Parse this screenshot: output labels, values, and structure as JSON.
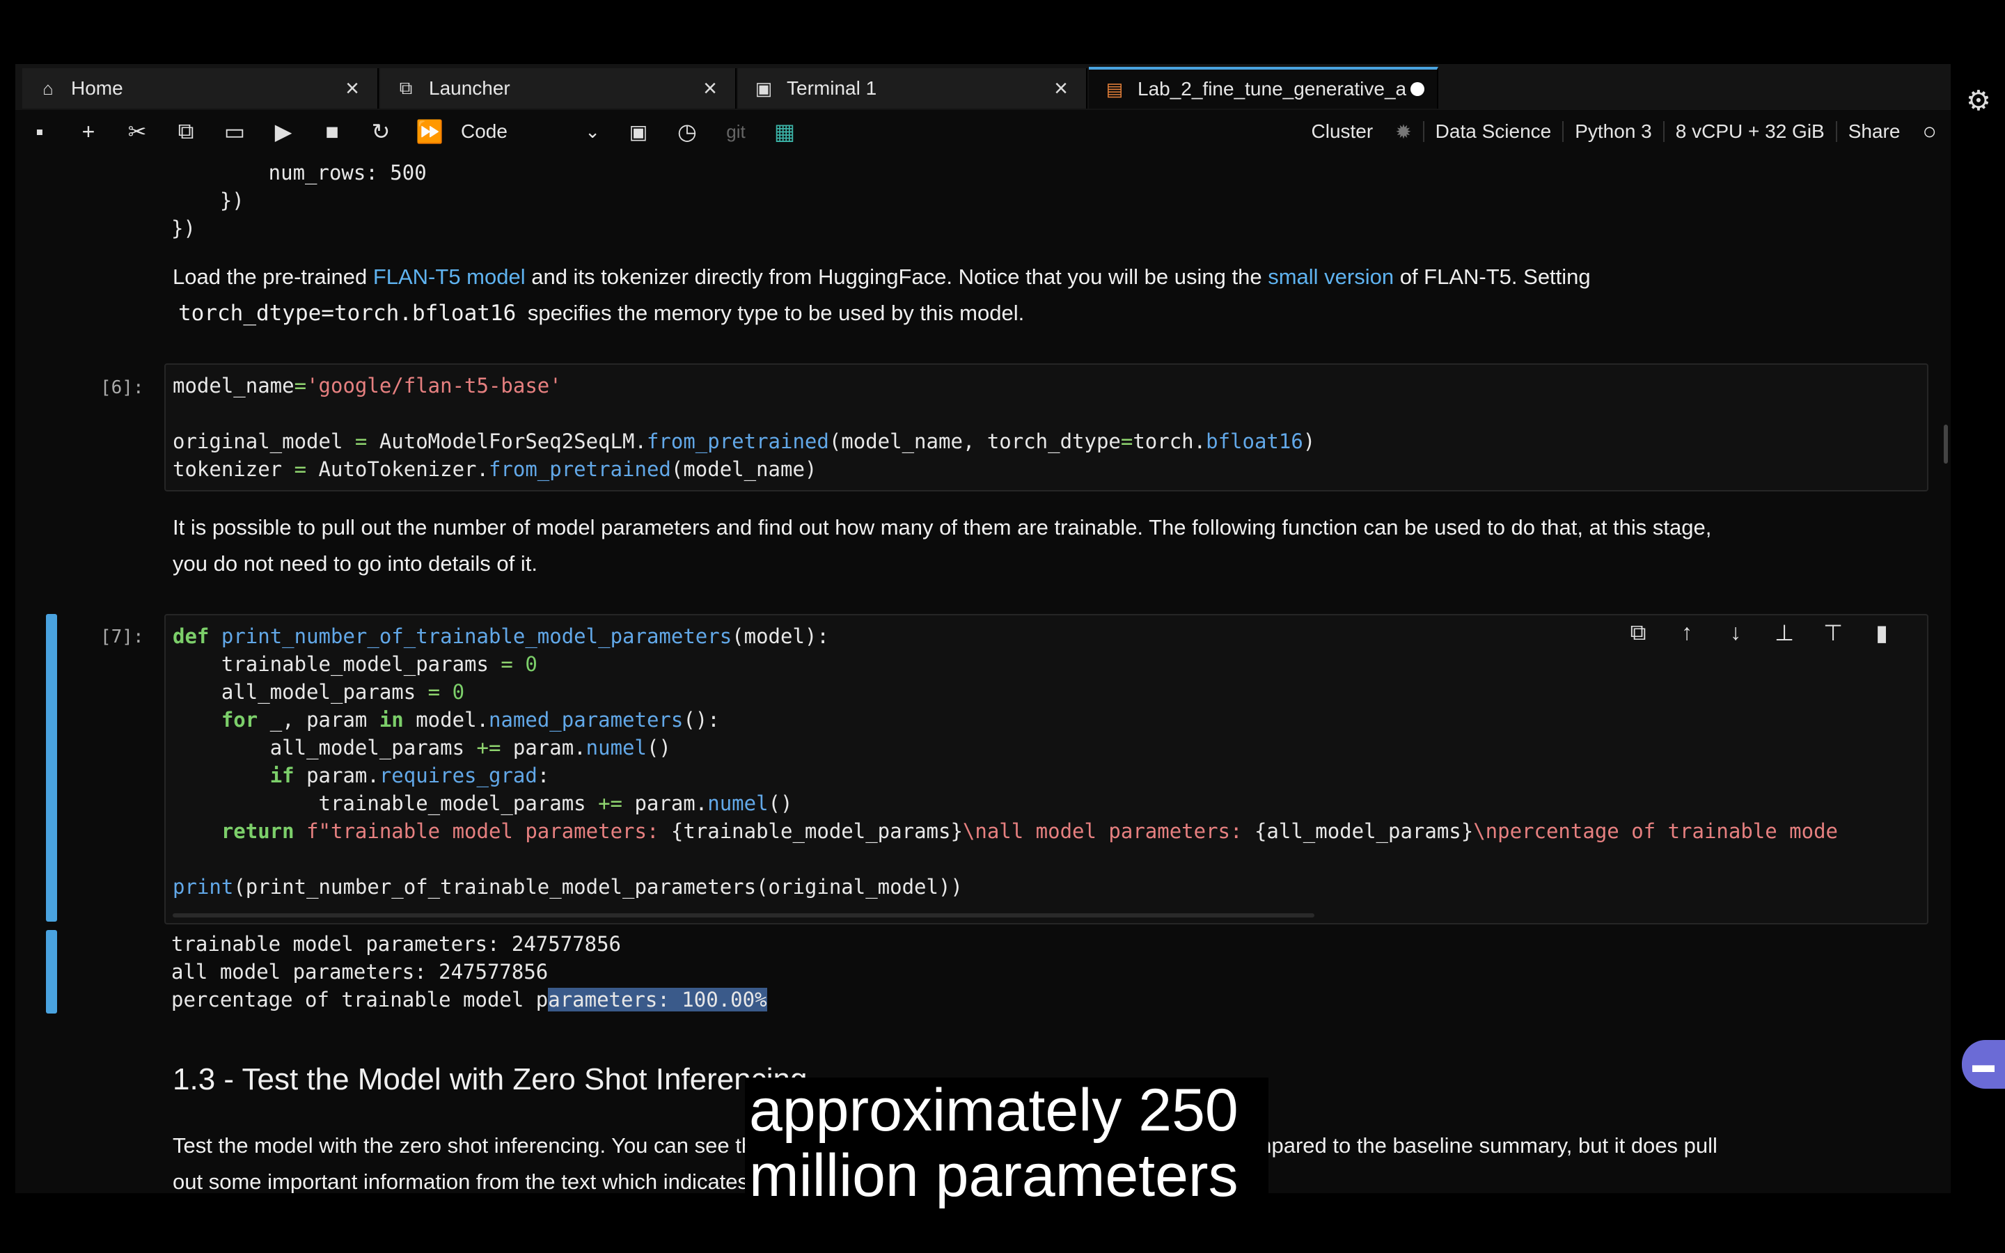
{
  "tabs": [
    {
      "icon": "home-icon",
      "label": "Home",
      "close": "×"
    },
    {
      "icon": "launcher-icon",
      "label": "Launcher",
      "close": "×"
    },
    {
      "icon": "terminal-icon",
      "label": "Terminal 1",
      "close": "×"
    },
    {
      "icon": "notebook-icon",
      "label": "Lab_2_fine_tune_generative_a"
    }
  ],
  "toolbar": {
    "cell_type": "Code",
    "git": "git",
    "cluster": "Cluster",
    "image": "Data Science",
    "kernel": "Python 3",
    "instance": "8 vCPU + 32 GiB",
    "share": "Share"
  },
  "output_top": {
    "line1": "        num_rows: 500",
    "line2": "    })",
    "line3": "})"
  },
  "md1": {
    "t1": "Load the pre-trained ",
    "link1": "FLAN-T5 model",
    "t2": " and its tokenizer directly from HuggingFace. Notice that you will be using the ",
    "link2": "small version",
    "t3": " of FLAN-T5. Setting",
    "code": "torch_dtype=torch.bfloat16",
    "t4": " specifies the memory type to be used by this model."
  },
  "cell6": {
    "prompt": "[6]:",
    "l1a": "model_name",
    "l1b": "=",
    "l1c": "'google/flan-t5-base'",
    "l2a": "original_model",
    "l2b": " = ",
    "l2c": "AutoModelForSeq2SeqLM.",
    "l2d": "from_pretrained",
    "l2e": "(model_name, torch_dtype",
    "l2f": "=",
    "l2g": "torch.",
    "l2h": "bfloat16",
    "l2i": ")",
    "l3a": "tokenizer",
    "l3b": " = ",
    "l3c": "AutoTokenizer.",
    "l3d": "from_pretrained",
    "l3e": "(model_name)"
  },
  "md2": {
    "line1": "It is possible to pull out the number of model parameters and find out how many of them are trainable. The following function can be used to do that, at this stage,",
    "line2": "you do not need to go into details of it."
  },
  "cell7": {
    "prompt": "[7]:",
    "def": "def",
    "fname": "print_number_of_trainable_model_parameters",
    "fargs": "(model):",
    "v1": "trainable_model_params",
    "eq": " = ",
    "zero": "0",
    "v2": "all_model_params",
    "for": "for",
    "forvars": " _, param ",
    "in": "in",
    "forobj": " model.",
    "named": "named_parameters",
    "forend": "():",
    "pluseq": " += ",
    "paramdot": "param.",
    "numel": "numel",
    "paren": "()",
    "if": "if",
    "req": "requires_grad",
    "colon": ":",
    "return": "return",
    "f1": "f\"trainable model parameters: ",
    "b1": "{trainable_model_params}",
    "f2": "\\nall model parameters: ",
    "b2": "{all_model_params}",
    "f3": "\\npercentage of trainable mode",
    "print": "print",
    "printargs": "(print_number_of_trainable_model_parameters(original_model))"
  },
  "output7": {
    "line1": "trainable model parameters: 247577856",
    "line2": "all model parameters: 247577856",
    "line3a": "percentage of trainable model p",
    "line3b": "arameters: 100.00%"
  },
  "heading": "1.3 - Test the Model with Zero Shot Inferencing",
  "md3": {
    "line1": "Test the model with the zero shot inferencing. You can see that the model struggles to summarize the dialogue compared to the baseline summary, but it does pull",
    "line2": "out some important information from the text which indicates the model can be fine-tuned to the task at hand."
  },
  "caption": {
    "line1": "approximately 250",
    "line2": "million parameters"
  }
}
